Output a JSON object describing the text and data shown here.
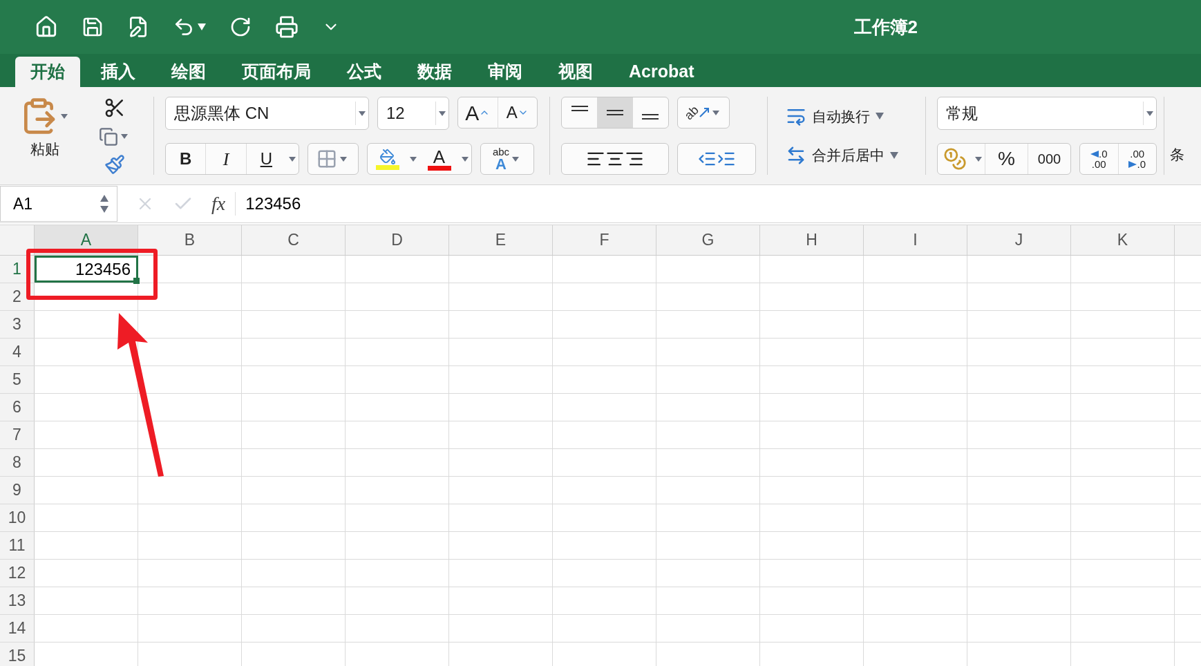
{
  "window": {
    "title": "工作簿2"
  },
  "tabs": [
    {
      "label": "开始",
      "selected": true
    },
    {
      "label": "插入",
      "selected": false
    },
    {
      "label": "绘图",
      "selected": false
    },
    {
      "label": "页面布局",
      "selected": false
    },
    {
      "label": "公式",
      "selected": false
    },
    {
      "label": "数据",
      "selected": false
    },
    {
      "label": "审阅",
      "selected": false
    },
    {
      "label": "视图",
      "selected": false
    },
    {
      "label": "Acrobat",
      "selected": false
    }
  ],
  "ribbon": {
    "paste": "粘贴",
    "font_name": "思源黑体 CN",
    "font_size": "12",
    "grow_font": "A",
    "shrink_font": "A",
    "bold": "B",
    "italic": "I",
    "underline": "U",
    "font_color": "A",
    "phonetic_top": "abc",
    "phonetic_bottom": "A",
    "vertical_align": [
      {
        "selected": false
      },
      {
        "selected": true
      },
      {
        "selected": false
      }
    ],
    "wrap_text": "自动换行",
    "merge_center": "合并后居中",
    "number_format": "常规",
    "percent": "%",
    "thousands": "000",
    "increase_decimal": {
      "top": ".0",
      "bottom": ".00"
    },
    "decrease_decimal": {
      "top": ".00",
      "bottom": ".0"
    },
    "edge_label": "条",
    "orientation": "ab"
  },
  "formula_bar": {
    "name_box": "A1",
    "fx": "fx",
    "value": "123456"
  },
  "sheet": {
    "columns": [
      {
        "label": "A",
        "selected": true
      },
      {
        "label": "B",
        "selected": false
      },
      {
        "label": "C",
        "selected": false
      },
      {
        "label": "D",
        "selected": false
      },
      {
        "label": "E",
        "selected": false
      },
      {
        "label": "F",
        "selected": false
      },
      {
        "label": "G",
        "selected": false
      },
      {
        "label": "H",
        "selected": false
      },
      {
        "label": "I",
        "selected": false
      },
      {
        "label": "J",
        "selected": false
      },
      {
        "label": "K",
        "selected": false
      }
    ],
    "rows": [
      {
        "label": "1",
        "selected": true,
        "cell_a": "123456"
      },
      {
        "label": "2",
        "selected": false
      },
      {
        "label": "3",
        "selected": false
      },
      {
        "label": "4",
        "selected": false
      },
      {
        "label": "5",
        "selected": false
      },
      {
        "label": "6",
        "selected": false
      },
      {
        "label": "7",
        "selected": false
      },
      {
        "label": "8",
        "selected": false
      },
      {
        "label": "9",
        "selected": false
      },
      {
        "label": "10",
        "selected": false
      },
      {
        "label": "11",
        "selected": false
      },
      {
        "label": "12",
        "selected": false
      },
      {
        "label": "13",
        "selected": false
      },
      {
        "label": "14",
        "selected": false
      },
      {
        "label": "15",
        "selected": false
      }
    ]
  }
}
